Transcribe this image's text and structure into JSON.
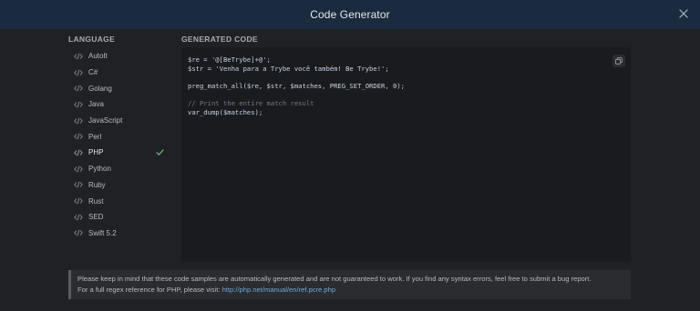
{
  "header": {
    "title": "Code Generator"
  },
  "language_column": {
    "heading": "LANGUAGE",
    "items": [
      {
        "label": "AutoIt",
        "selected": false
      },
      {
        "label": "C#",
        "selected": false
      },
      {
        "label": "Golang",
        "selected": false
      },
      {
        "label": "Java",
        "selected": false
      },
      {
        "label": "JavaScript",
        "selected": false
      },
      {
        "label": "Perl",
        "selected": false
      },
      {
        "label": "PHP",
        "selected": true
      },
      {
        "label": "Python",
        "selected": false
      },
      {
        "label": "Ruby",
        "selected": false
      },
      {
        "label": "Rust",
        "selected": false
      },
      {
        "label": "SED",
        "selected": false
      },
      {
        "label": "Swift 5.2",
        "selected": false
      }
    ]
  },
  "code_column": {
    "heading": "GENERATED CODE",
    "lines": [
      "$re = '@[BeTrybe]+@';",
      "$str = 'Venha para a Trybe você também! Be Trybe!';",
      "",
      "preg_match_all($re, $str, $matches, PREG_SET_ORDER, 0);",
      "",
      "// Print the entire match result",
      "var_dump($matches);"
    ]
  },
  "notice": {
    "text": "Please keep in mind that these code samples are automatically generated and are not guaranteed to work. If you find any syntax errors, feel free to submit a bug report.",
    "reference_prefix": "For a full regex reference for PHP, please visit: ",
    "reference_link": "http://php.net/manual/en/ref.pcre.php"
  },
  "colors": {
    "header_bg": "#1a2b3f",
    "panel_bg": "#202124",
    "code_bg": "#1a1b1e",
    "check_color": "#7ab88a",
    "link_color": "#6fa8d6"
  },
  "icons": {
    "close": "close-icon",
    "language_item": "code-brackets-icon",
    "selected": "check-icon",
    "copy": "copy-icon"
  }
}
